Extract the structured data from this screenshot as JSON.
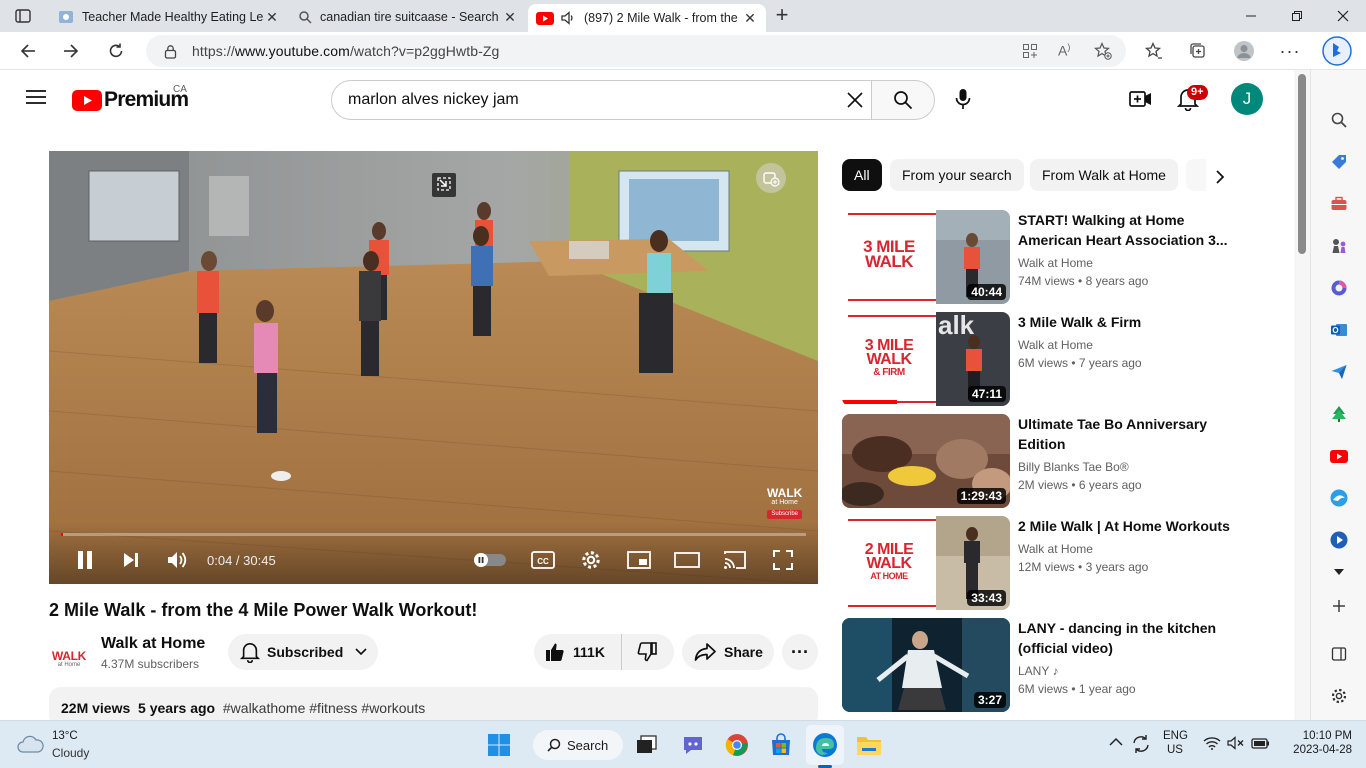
{
  "browser": {
    "tabs": [
      {
        "title": "Teacher Made Healthy Eating Les"
      },
      {
        "title": "canadian tire suitcaase - Search"
      },
      {
        "title": "(897) 2 Mile Walk - from the"
      }
    ],
    "url_prefix": "https://",
    "url_host": "www.youtube.com",
    "url_path": "/watch?v=p2ggHwtb-Zg"
  },
  "youtube": {
    "brand": "Premium",
    "country": "CA",
    "search_value": "marlon alves nickey jam",
    "notifications": "9+",
    "avatar": "J"
  },
  "player": {
    "time": "0:04 / 30:45",
    "progress": 0.002,
    "watermark_line1": "WALK",
    "watermark_line2": "at Home",
    "watermark_sub": "Subscribe"
  },
  "video": {
    "title": "2 Mile Walk - from the 4 Mile Power Walk Workout!",
    "channel": "Walk at Home",
    "subscribers": "4.37M subscribers",
    "subscribed_label": "Subscribed",
    "likes": "111K",
    "share_label": "Share",
    "views": "22M views",
    "age": "5 years ago",
    "hashtags": "#walkathome #fitness #workouts",
    "logo_text": "WALK",
    "logo_sub": "at Home"
  },
  "chips": [
    "All",
    "From your search",
    "From Walk at Home"
  ],
  "recommendations": [
    {
      "title": "START! Walking at Home American Heart Association 3...",
      "channel": "Walk at Home",
      "views": "74M views",
      "age": "8 years ago",
      "duration": "40:44",
      "thumb_line1": "3 MILE",
      "thumb_line2": "WALK",
      "thumb_line3": ""
    },
    {
      "title": "3 Mile Walk & Firm",
      "channel": "Walk at Home",
      "views": "6M views",
      "age": "7 years ago",
      "duration": "47:11",
      "thumb_line1": "3 MILE",
      "thumb_line2": "WALK",
      "thumb_line3": "& FIRM"
    },
    {
      "title": "Ultimate Tae Bo Anniversary Edition",
      "channel": "Billy Blanks Tae Bo®",
      "views": "2M views",
      "age": "6 years ago",
      "duration": "1:29:43"
    },
    {
      "title": "2 Mile Walk | At Home Workouts",
      "channel": "Walk at Home",
      "views": "12M views",
      "age": "3 years ago",
      "duration": "33:43",
      "thumb_line1": "2 MILE",
      "thumb_line2": "WALK",
      "thumb_line3": "AT HOME"
    },
    {
      "title": "LANY - dancing in the kitchen (official video)",
      "channel": "LANY",
      "views": "6M views",
      "age": "1 year ago",
      "duration": "3:27"
    }
  ],
  "taskbar": {
    "temp": "13°C",
    "weather": "Cloudy",
    "search_label": "Search",
    "lang1": "ENG",
    "lang2": "US",
    "time": "10:10 PM",
    "date": "2023-04-28"
  },
  "colors": {
    "yt_red": "#ff0000",
    "accent_teal": "#00897b",
    "walk_red": "#d7262f"
  }
}
